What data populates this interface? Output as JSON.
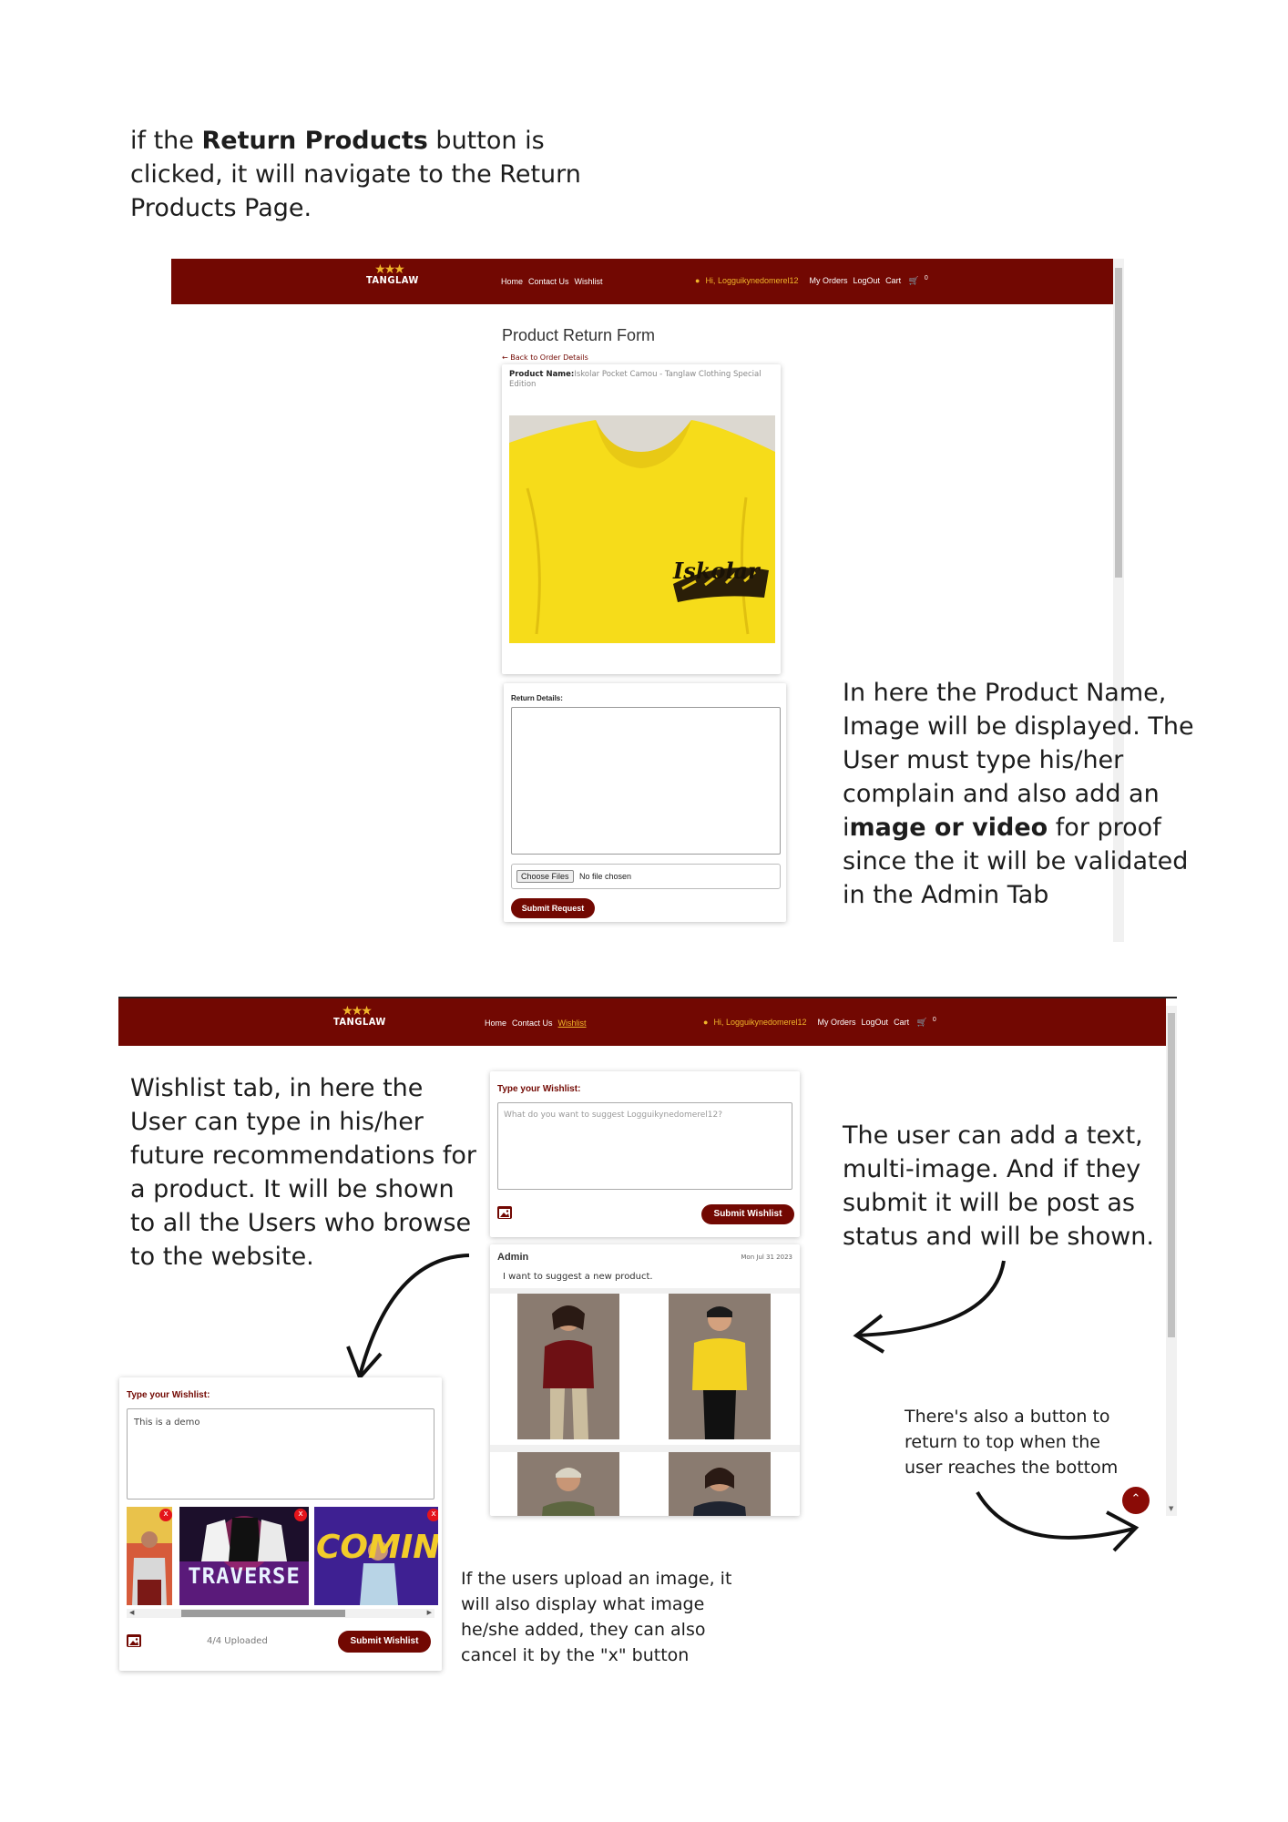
{
  "intro_note": {
    "part1": "if the ",
    "bold": "Return Products",
    "part2": " button is clicked, it will navigate to the Return Products Page."
  },
  "navbar": {
    "brand": "TANGLAW",
    "links": [
      "Home",
      "Contact Us",
      "Wishlist"
    ],
    "user_greeting": "Hi, Logguikynedomerel12",
    "my_orders": "My Orders",
    "logout": "LogOut",
    "cart": "Cart",
    "cart_count": "0"
  },
  "navbar2": {
    "user_greeting": "Hi, Logguikynedomerel12"
  },
  "return_form": {
    "title": "Product Return Form",
    "back_link": "← Back to Order Details",
    "product_name_label": "Product Name:",
    "product_name": "Iskolar Pocket Camou - Tanglaw Clothing Special Edition",
    "shirt_text": "Iskolar",
    "return_details_label": "Return Details:",
    "choose_files": "Choose Files",
    "no_file": "No file chosen",
    "submit": "Submit Request"
  },
  "right_note": {
    "part1": "In here the Product Name, Image will be displayed. The User must type his/her complain and also add an i",
    "bold": "mage or video",
    "part2": " for proof since the it will be validated in the Admin Tab"
  },
  "wishlist_note": "Wishlist tab, in here the User can type in his/her future recommendations for a product. It will be shown to all the Users who browse to the website.",
  "wishlist_form": {
    "label": "Type your Wishlist:",
    "placeholder": "What do you want to suggest Logguikynedomerel12?",
    "submit": "Submit Wishlist"
  },
  "post": {
    "author": "Admin",
    "date": "Mon Jul 31 2023",
    "text": "I want to suggest a new product."
  },
  "multi_image_note": "The user can add a text, multi-image. And if they submit it will be post as status and will be shown.",
  "top_button_note": "There's also a button to return to top when the user reaches the bottom",
  "demo_form": {
    "label": "Type your Wishlist:",
    "value": "This is a demo",
    "thumb2_text": "TRAVERSE",
    "thumb3_text": "COMING SO",
    "remove": "x",
    "uploaded": "4/4 Uploaded",
    "submit": "Submit Wishlist"
  },
  "upload_note": "If the users upload an image, it will also display what image he/she added, they can also cancel it by the \"x\" button",
  "colors": {
    "brand": "#720802",
    "accent": "#f0b52a"
  }
}
